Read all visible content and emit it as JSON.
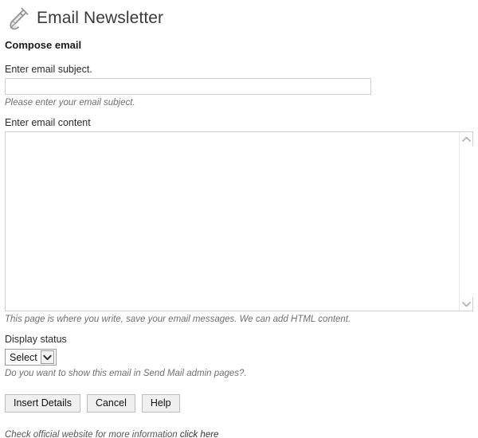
{
  "header": {
    "icon": "plug-icon",
    "title": "Email Newsletter"
  },
  "section": {
    "heading": "Compose email"
  },
  "subject": {
    "label": "Enter email subject.",
    "value": "",
    "placeholder": "",
    "hint": "Please enter your email subject."
  },
  "content": {
    "label": "Enter email content",
    "value": "",
    "placeholder": "",
    "hint": "This page is where you write, save your email messages. We can add HTML content.",
    "scrollbar": {
      "up_icon": "chevron-up-icon",
      "down_icon": "chevron-down-icon"
    }
  },
  "display_status": {
    "label": "Display status",
    "selected": "Select",
    "options": [
      "Select"
    ],
    "arrow_icon": "chevron-down-icon",
    "hint": "Do you want to show this email in Send Mail admin pages?."
  },
  "buttons": [
    {
      "label": "Insert Details",
      "name": "insert-details-button"
    },
    {
      "label": "Cancel",
      "name": "cancel-button"
    },
    {
      "label": "Help",
      "name": "help-button"
    }
  ],
  "footer": {
    "text": "Check official website for more information",
    "link_label": "click here"
  },
  "colors": {
    "page_background": "#ffffff",
    "title_text": "#3a3a3a",
    "body_text": "#222222",
    "hint_text": "#6f6f6f",
    "input_border": "#cfcfcf",
    "button_face": "#f0f0f0",
    "button_border": "#bdbdbd",
    "link": "#333333"
  }
}
